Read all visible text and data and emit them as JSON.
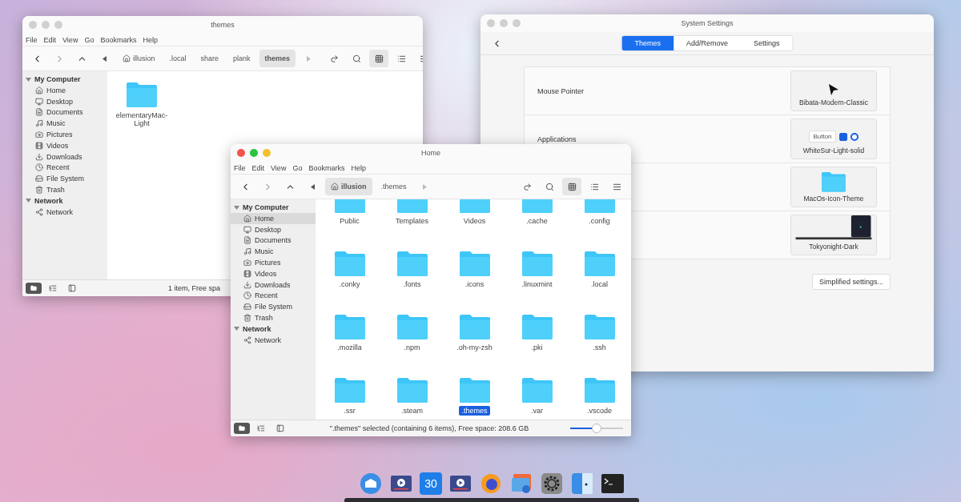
{
  "back_file_manager": {
    "title": "themes",
    "active": false,
    "menu": [
      "File",
      "Edit",
      "View",
      "Go",
      "Bookmarks",
      "Help"
    ],
    "breadcrumbs": [
      {
        "label": "illusion",
        "kind": "home",
        "selected": false
      },
      {
        "label": ".local",
        "kind": "plain",
        "selected": false
      },
      {
        "label": "share",
        "kind": "plain",
        "selected": false
      },
      {
        "label": "plank",
        "kind": "plain",
        "selected": false
      },
      {
        "label": "themes",
        "kind": "plain",
        "selected": true
      }
    ],
    "sidebar": [
      {
        "title": "My Computer",
        "expanded": true,
        "items": [
          {
            "label": "Home",
            "selected": false
          },
          {
            "label": "Desktop",
            "selected": false
          },
          {
            "label": "Documents",
            "selected": false
          },
          {
            "label": "Music",
            "selected": false
          },
          {
            "label": "Pictures",
            "selected": false
          },
          {
            "label": "Videos",
            "selected": false
          },
          {
            "label": "Downloads",
            "selected": false
          },
          {
            "label": "Recent",
            "selected": false
          },
          {
            "label": "File System",
            "selected": false
          },
          {
            "label": "Trash",
            "selected": false
          }
        ]
      },
      {
        "title": "Network",
        "expanded": true,
        "items": [
          {
            "label": "Network",
            "selected": false
          }
        ]
      }
    ],
    "files": [
      {
        "name": "elementaryMac-Light",
        "selected": false
      }
    ],
    "status": "1 item, Free spa"
  },
  "settings_window": {
    "title": "System Settings",
    "tabs": [
      {
        "label": "Themes",
        "selected": true
      },
      {
        "label": "Add/Remove",
        "selected": false
      },
      {
        "label": "Settings",
        "selected": false
      }
    ],
    "rows": [
      {
        "label": "Mouse Pointer",
        "value": "Bibata-Modern-Classic",
        "kind": "pointer"
      },
      {
        "label": "Applications",
        "value": "WhiteSur-Light-solid",
        "kind": "widgets",
        "preview": {
          "button": "Button",
          "checked": true,
          "radio_selected": true
        }
      },
      {
        "value": "MacOs-Icon-Theme",
        "kind": "folder"
      },
      {
        "value": "Tokyonight-Dark",
        "kind": "desktop"
      }
    ],
    "button": "Simplified settings..."
  },
  "front_file_manager": {
    "title": "Home",
    "active": true,
    "menu": [
      "File",
      "Edit",
      "View",
      "Go",
      "Bookmarks",
      "Help"
    ],
    "breadcrumbs": [
      {
        "label": "illusion",
        "kind": "home",
        "selected": true
      },
      {
        "label": ".themes",
        "kind": "plain",
        "selected": false
      }
    ],
    "sidebar": [
      {
        "title": "My Computer",
        "expanded": true,
        "items": [
          {
            "label": "Home",
            "selected": true
          },
          {
            "label": "Desktop",
            "selected": false
          },
          {
            "label": "Documents",
            "selected": false
          },
          {
            "label": "Music",
            "selected": false
          },
          {
            "label": "Pictures",
            "selected": false
          },
          {
            "label": "Videos",
            "selected": false
          },
          {
            "label": "Downloads",
            "selected": false
          },
          {
            "label": "Recent",
            "selected": false
          },
          {
            "label": "File System",
            "selected": false
          },
          {
            "label": "Trash",
            "selected": false
          }
        ]
      },
      {
        "title": "Network",
        "expanded": true,
        "items": [
          {
            "label": "Network",
            "selected": false
          }
        ]
      }
    ],
    "files": [
      {
        "name": "Public",
        "selected": false
      },
      {
        "name": "Templates",
        "selected": false
      },
      {
        "name": "Videos",
        "selected": false
      },
      {
        "name": ".cache",
        "selected": false
      },
      {
        "name": ".config",
        "selected": false
      },
      {
        "name": ".conky",
        "selected": false
      },
      {
        "name": ".fonts",
        "selected": false
      },
      {
        "name": ".icons",
        "selected": false
      },
      {
        "name": ".linuxmint",
        "selected": false
      },
      {
        "name": ".local",
        "selected": false
      },
      {
        "name": ".mozilla",
        "selected": false
      },
      {
        "name": ".npm",
        "selected": false
      },
      {
        "name": ".oh-my-zsh",
        "selected": false
      },
      {
        "name": ".pki",
        "selected": false
      },
      {
        "name": ".ssh",
        "selected": false
      },
      {
        "name": ".ssr",
        "selected": false
      },
      {
        "name": ".steam",
        "selected": false
      },
      {
        "name": ".themes",
        "selected": true
      },
      {
        "name": ".var",
        "selected": false
      },
      {
        "name": ".vscode",
        "selected": false
      }
    ],
    "status": "\".themes\" selected (containing 6 items), Free space: 208.6 GB",
    "zoom": {
      "level": 0.5
    }
  },
  "dock": [
    {
      "kind": "mail"
    },
    {
      "kind": "video"
    },
    {
      "kind": "calendar",
      "label": "30"
    },
    {
      "kind": "video"
    },
    {
      "kind": "browser"
    },
    {
      "kind": "photos"
    },
    {
      "kind": "settings"
    },
    {
      "kind": "finder"
    },
    {
      "kind": "terminal"
    }
  ]
}
